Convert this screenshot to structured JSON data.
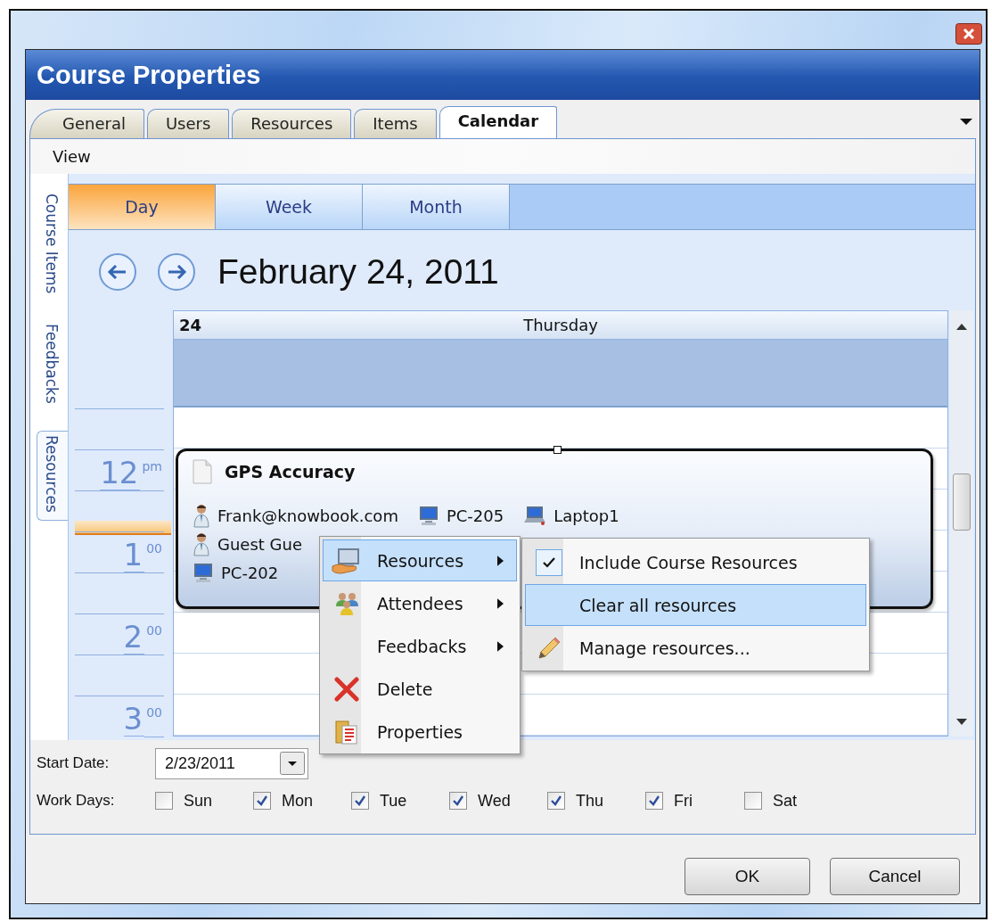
{
  "window": {
    "title": "Course Properties"
  },
  "tabs": [
    {
      "label": "General",
      "selected": false
    },
    {
      "label": "Users",
      "selected": false
    },
    {
      "label": "Resources",
      "selected": false
    },
    {
      "label": "Items",
      "selected": false
    },
    {
      "label": "Calendar",
      "selected": true
    }
  ],
  "menu_bar": [
    "View"
  ],
  "side_tabs": [
    {
      "label": "Course Items",
      "selected": false
    },
    {
      "label": "Feedbacks",
      "selected": false
    },
    {
      "label": "Resources",
      "selected": true
    }
  ],
  "view_buttons": [
    {
      "label": "Day",
      "selected": true
    },
    {
      "label": "Week",
      "selected": false
    },
    {
      "label": "Month",
      "selected": false
    }
  ],
  "date_title": "February 24, 2011",
  "day_header": {
    "day_number": "24",
    "weekday": "Thursday"
  },
  "hour_labels": [
    {
      "hour": "12",
      "suffix": "pm"
    },
    {
      "hour": "1",
      "suffix": "00"
    },
    {
      "hour": "2",
      "suffix": "00"
    },
    {
      "hour": "3",
      "suffix": "00"
    }
  ],
  "appointment": {
    "title": "GPS Accuracy",
    "resource_lines": [
      [
        {
          "kind": "person",
          "label": "Frank@knowbook.com"
        },
        {
          "kind": "computer",
          "label": "PC-205"
        },
        {
          "kind": "laptop",
          "label": "Laptop1"
        }
      ],
      [
        {
          "kind": "person",
          "label": "Guest Gue"
        }
      ],
      [
        {
          "kind": "computer",
          "label": "PC-202"
        }
      ]
    ]
  },
  "context_menu": [
    {
      "kind": "resources",
      "label": "Resources",
      "submenu": true,
      "selected": true
    },
    {
      "kind": "attendees",
      "label": "Attendees",
      "submenu": true,
      "selected": false
    },
    {
      "kind": "plain",
      "label": "Feedbacks",
      "submenu": true,
      "selected": false
    },
    {
      "kind": "delete",
      "label": "Delete",
      "submenu": false,
      "selected": false
    },
    {
      "kind": "properties",
      "label": "Properties",
      "submenu": false,
      "selected": false
    }
  ],
  "submenu": [
    {
      "kind": "check",
      "label": "Include Course Resources",
      "checked": true,
      "selected": false
    },
    {
      "kind": "plain",
      "label": "Clear all resources",
      "selected": true
    },
    {
      "kind": "pencil",
      "label": "Manage resources...",
      "selected": false
    }
  ],
  "start_date": {
    "label": "Start Date:",
    "value": "2/23/2011"
  },
  "work_days": {
    "label": "Work Days:",
    "days": [
      {
        "label": "Sun",
        "checked": false
      },
      {
        "label": "Mon",
        "checked": true
      },
      {
        "label": "Tue",
        "checked": true
      },
      {
        "label": "Wed",
        "checked": true
      },
      {
        "label": "Thu",
        "checked": true
      },
      {
        "label": "Fri",
        "checked": true
      },
      {
        "label": "Sat",
        "checked": false
      }
    ]
  },
  "buttons": [
    "OK",
    "Cancel"
  ]
}
